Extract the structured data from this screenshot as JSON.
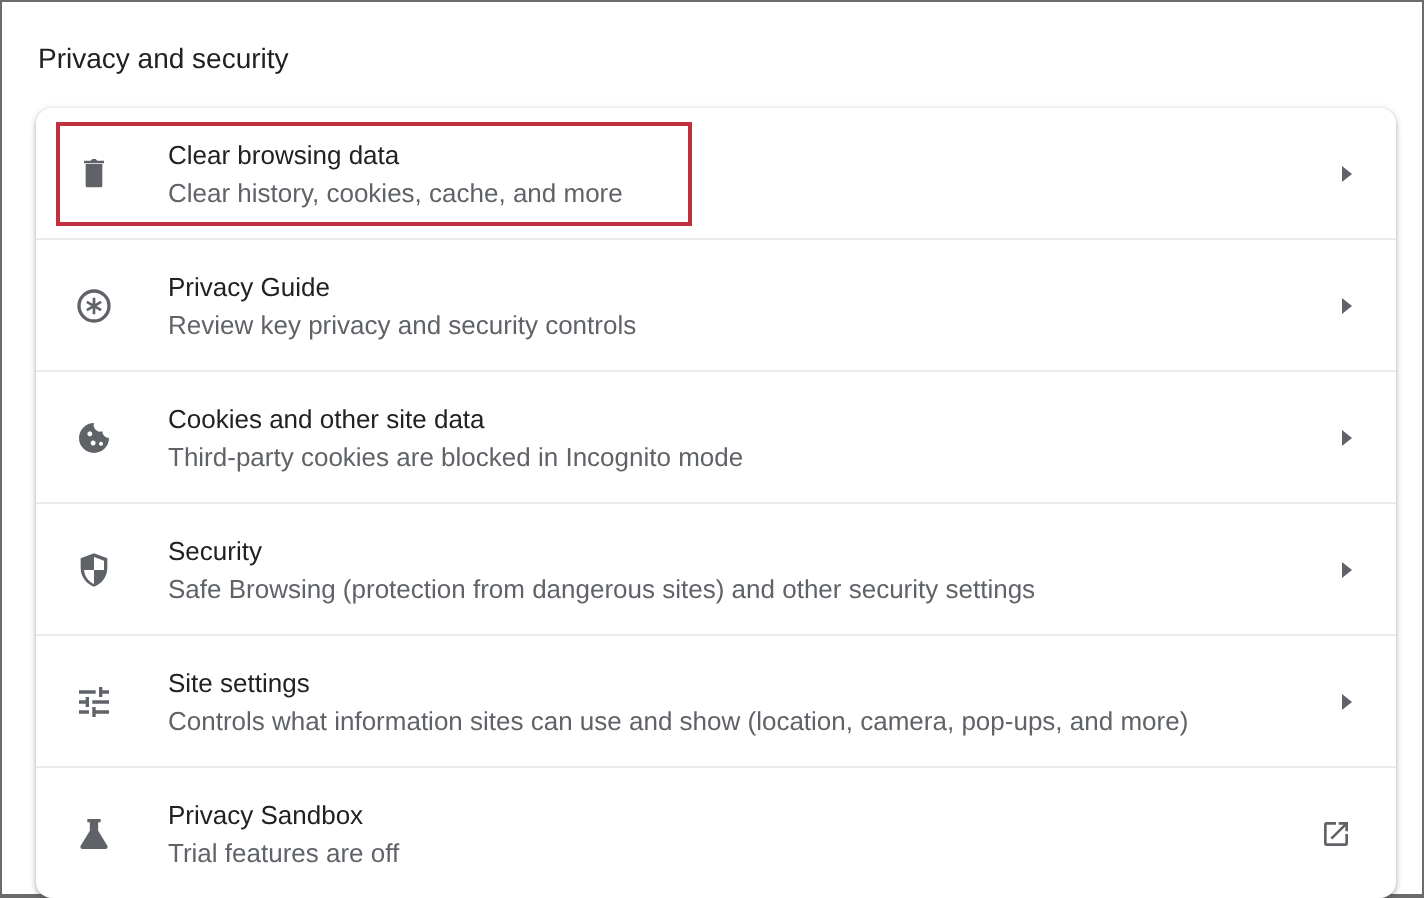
{
  "heading": "Privacy and security",
  "items": [
    {
      "title": "Clear browsing data",
      "subtitle": "Clear history, cookies, cache, and more",
      "kind": "submenu",
      "highlighted": true
    },
    {
      "title": "Privacy Guide",
      "subtitle": "Review key privacy and security controls",
      "kind": "submenu",
      "highlighted": false
    },
    {
      "title": "Cookies and other site data",
      "subtitle": "Third-party cookies are blocked in Incognito mode",
      "kind": "submenu",
      "highlighted": false
    },
    {
      "title": "Security",
      "subtitle": "Safe Browsing (protection from dangerous sites) and other security settings",
      "kind": "submenu",
      "highlighted": false
    },
    {
      "title": "Site settings",
      "subtitle": "Controls what information sites can use and show (location, camera, pop-ups, and more)",
      "kind": "submenu",
      "highlighted": false
    },
    {
      "title": "Privacy Sandbox",
      "subtitle": "Trial features are off",
      "kind": "external",
      "highlighted": false
    }
  ]
}
